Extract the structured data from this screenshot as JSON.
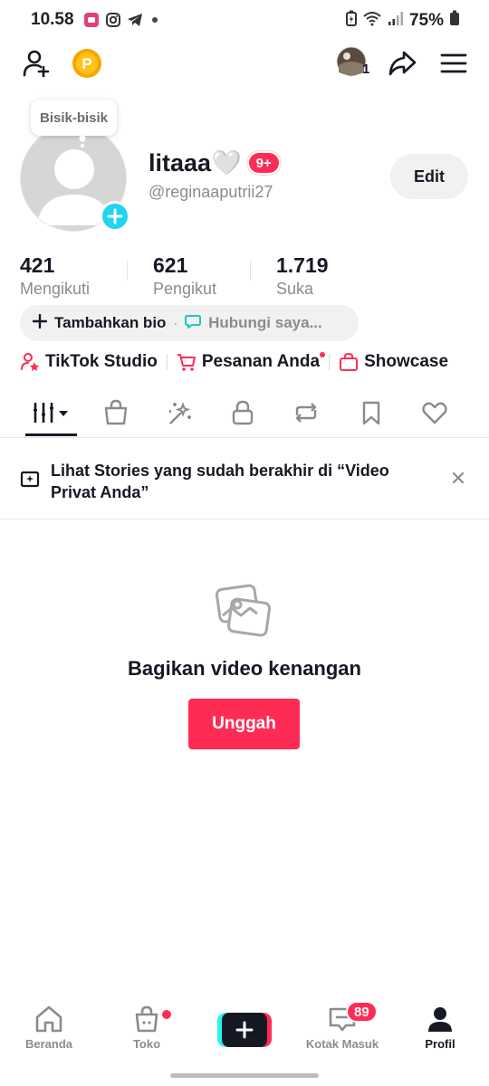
{
  "status_bar": {
    "time": "10.58",
    "battery": "75%",
    "app_icons": [
      "loca-icon",
      "instagram-icon",
      "telegram-icon",
      "dot-icon"
    ],
    "right_icons": [
      "battery-saver-icon",
      "wifi-icon",
      "signal-icon",
      "battery-icon"
    ]
  },
  "header": {
    "add_friend_icon": "person-add-icon",
    "coin_icon": "coin-icon",
    "coin_letter": "P",
    "story_avatar_count": "1",
    "share_icon": "share-icon",
    "menu_icon": "hamburger-menu-icon"
  },
  "profile": {
    "bubble": "Bisik-bisik",
    "name": "litaaa🤍",
    "notification_badge": "9+",
    "handle": "@reginaaputrii27",
    "edit_label": "Edit"
  },
  "stats": [
    {
      "value": "421",
      "label": "Mengikuti"
    },
    {
      "value": "621",
      "label": "Pengikut"
    },
    {
      "value": "1.719",
      "label": "Suka"
    }
  ],
  "bio": {
    "add_label": "Tambahkan bio",
    "contact_label": "Hubungi saya..."
  },
  "links": [
    {
      "label": "TikTok Studio",
      "icon": "studio-icon"
    },
    {
      "label": "Pesanan Anda",
      "icon": "cart-icon"
    },
    {
      "label": "Showcase",
      "icon": "shopping-bag-icon"
    }
  ],
  "tabs": [
    "videos-grid-icon",
    "shop-bag-icon",
    "sparkle-icon",
    "lock-icon",
    "repost-icon",
    "bookmark-icon",
    "heart-icon"
  ],
  "notice": {
    "text": "Lihat Stories yang sudah berakhir di “Video Privat Anda”"
  },
  "empty_state": {
    "title": "Bagikan video kenangan",
    "button": "Unggah"
  },
  "bottom_nav": [
    {
      "label": "Beranda",
      "icon": "home-icon"
    },
    {
      "label": "Toko",
      "icon": "shop-icon"
    },
    {
      "label": "",
      "icon": "create-plus-icon"
    },
    {
      "label": "Kotak Masuk",
      "icon": "inbox-icon",
      "badge": "89"
    },
    {
      "label": "Profil",
      "icon": "profile-icon"
    }
  ],
  "colors": {
    "accent": "#fe2c55",
    "cyan": "#25f4ee",
    "text": "#161823",
    "muted": "#8a8b91"
  }
}
